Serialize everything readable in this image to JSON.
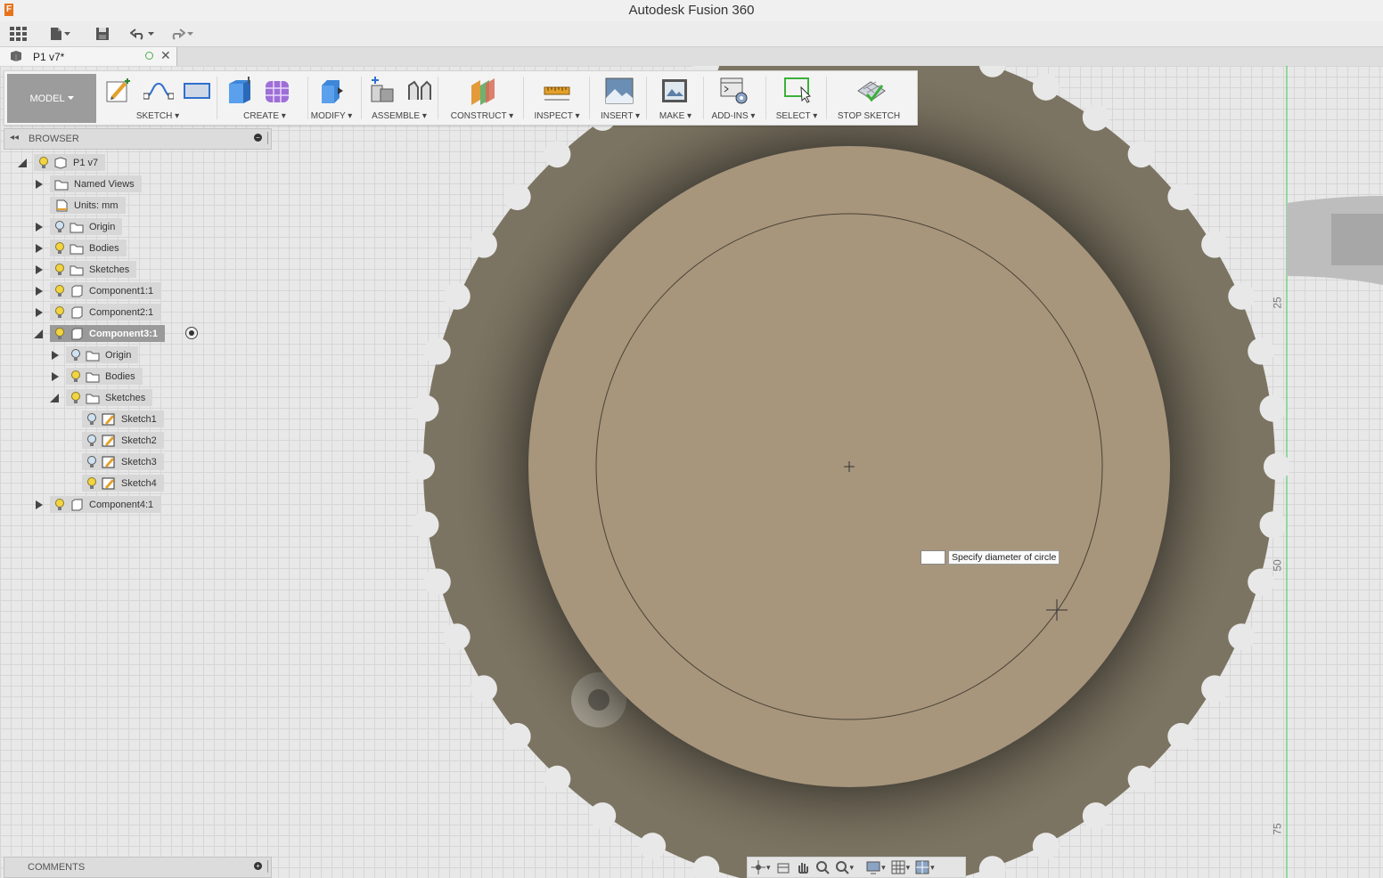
{
  "window": {
    "title": "Autodesk Fusion 360",
    "logo_letter": "F"
  },
  "quick_access": {
    "items": [
      "apps-grid-icon",
      "file-icon",
      "save-icon",
      "undo-icon",
      "redo-icon"
    ]
  },
  "document_tab": {
    "title": "P1 v7*"
  },
  "toolbar": {
    "workspace": "MODEL",
    "groups": {
      "sketch": "SKETCH",
      "create": "CREATE",
      "modify": "MODIFY",
      "assemble": "ASSEMBLE",
      "construct": "CONSTRUCT",
      "inspect": "INSPECT",
      "insert": "INSERT",
      "make": "MAKE",
      "addins": "ADD-INS",
      "select": "SELECT",
      "stop_sketch": "STOP SKETCH"
    }
  },
  "browser": {
    "title": "BROWSER",
    "tree": {
      "root": "P1 v7",
      "named_views": "Named Views",
      "units": "Units: mm",
      "origin": "Origin",
      "bodies": "Bodies",
      "sketches": "Sketches",
      "component1": "Component1:1",
      "component2": "Component2:1",
      "component3": "Component3:1",
      "c3_origin": "Origin",
      "c3_bodies": "Bodies",
      "c3_sketches": "Sketches",
      "sketch1": "Sketch1",
      "sketch2": "Sketch2",
      "sketch3": "Sketch3",
      "sketch4": "Sketch4",
      "component4": "Component4:1"
    }
  },
  "comments": {
    "title": "COMMENTS"
  },
  "viewport": {
    "tooltip": "Specify diameter of circle",
    "dimension_value": "",
    "ruler_labels": [
      "25",
      "50",
      "75"
    ],
    "colors": {
      "hub": "#a7967c",
      "sprocket": "#7c7462",
      "grid_bg": "#e8e8e8"
    }
  },
  "navigation_bar": {
    "items": [
      "orbit-icon",
      "look-at-icon",
      "pan-icon",
      "zoom-icon",
      "fit-icon",
      "display-settings-icon",
      "grid-icon",
      "viewports-icon"
    ]
  }
}
